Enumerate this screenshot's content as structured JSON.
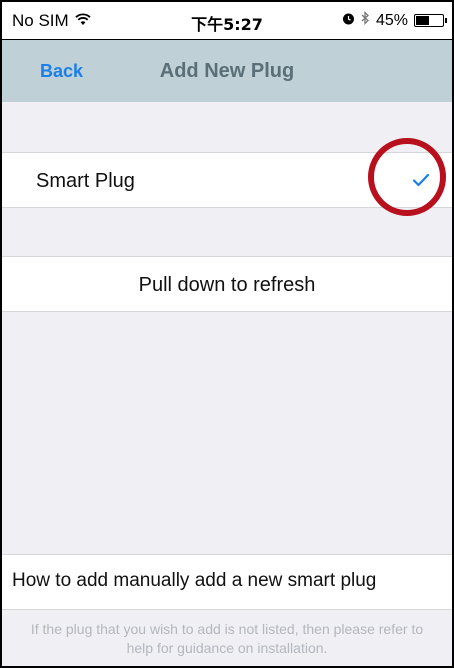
{
  "status_bar": {
    "carrier": "No SIM",
    "time": "下午5:27",
    "battery": "45%",
    "battery_level": 0.45
  },
  "nav": {
    "back_label": "Back",
    "title": "Add New Plug"
  },
  "plug_list": [
    {
      "label": "Smart Plug",
      "selected": true
    }
  ],
  "refresh_label": "Pull down to refresh",
  "manual_link": "How to add manually add a new smart plug",
  "footnote": "If the plug that you wish to add is not listed, then please refer to help for guidance on installation.",
  "colors": {
    "accent": "#1b7fe8",
    "nav_background": "#bfd0d6",
    "highlight_circle": "#b8101c"
  },
  "icons": {
    "wifi": "wifi-icon",
    "alarm": "alarm-icon",
    "bluetooth": "bluetooth-icon",
    "battery": "battery-icon",
    "check": "checkmark-icon"
  }
}
